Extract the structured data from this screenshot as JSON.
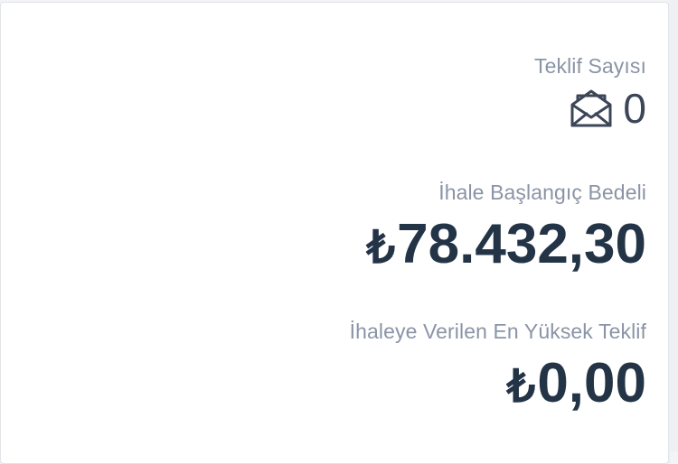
{
  "offers": {
    "label": "Teklif Sayısı",
    "count": "0",
    "icon": "envelope-open-icon"
  },
  "starting_price": {
    "label": "İhale Başlangıç Bedeli",
    "currency": "₺",
    "amount": "78.432,30"
  },
  "highest_offer": {
    "label": "İhaleye Verilen En Yüksek Teklif",
    "currency": "₺",
    "amount": "0,00"
  },
  "colors": {
    "label": "#8a94a6",
    "value": "#243447",
    "count": "#3c4658"
  }
}
